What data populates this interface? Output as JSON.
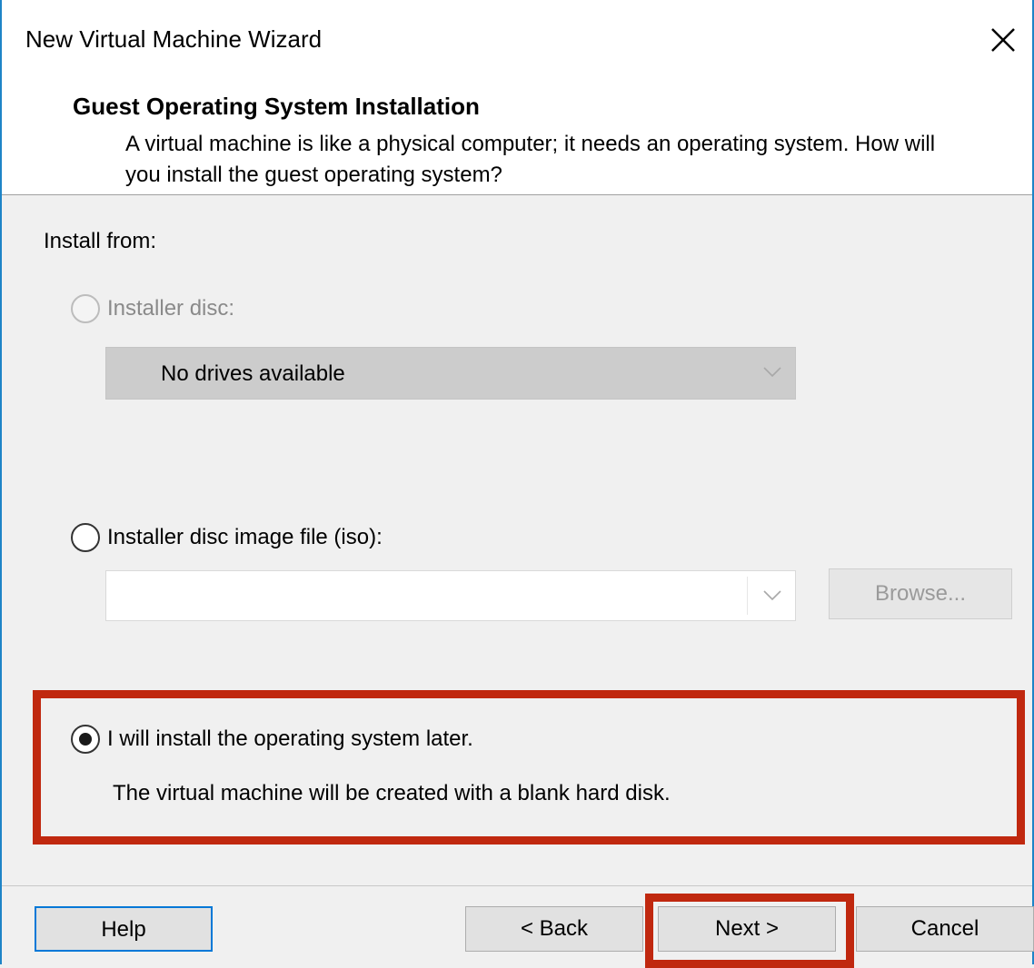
{
  "window": {
    "title": "New Virtual Machine Wizard",
    "close_icon": "close-icon"
  },
  "header": {
    "title": "Guest Operating System Installation",
    "description": "A virtual machine is like a physical computer; it needs an operating system. How will you install the guest operating system?"
  },
  "install_from": {
    "label": "Install from:",
    "options": [
      {
        "label": "Installer disc:",
        "selected": false,
        "enabled": false
      },
      {
        "label": "Installer disc image file (iso):",
        "selected": false,
        "enabled": true
      },
      {
        "label": "I will install the operating system later.",
        "selected": true,
        "enabled": true
      }
    ],
    "drive_select_value": "No drives available",
    "iso_path_value": "",
    "browse_label": "Browse...",
    "later_description": "The virtual machine will be created with a blank hard disk."
  },
  "buttons": {
    "help": "Help",
    "back": "< Back",
    "next": "Next >",
    "cancel": "Cancel"
  },
  "colors": {
    "highlight": "#c0280f",
    "window_border": "#1e84c7",
    "focus": "#0078d7"
  }
}
